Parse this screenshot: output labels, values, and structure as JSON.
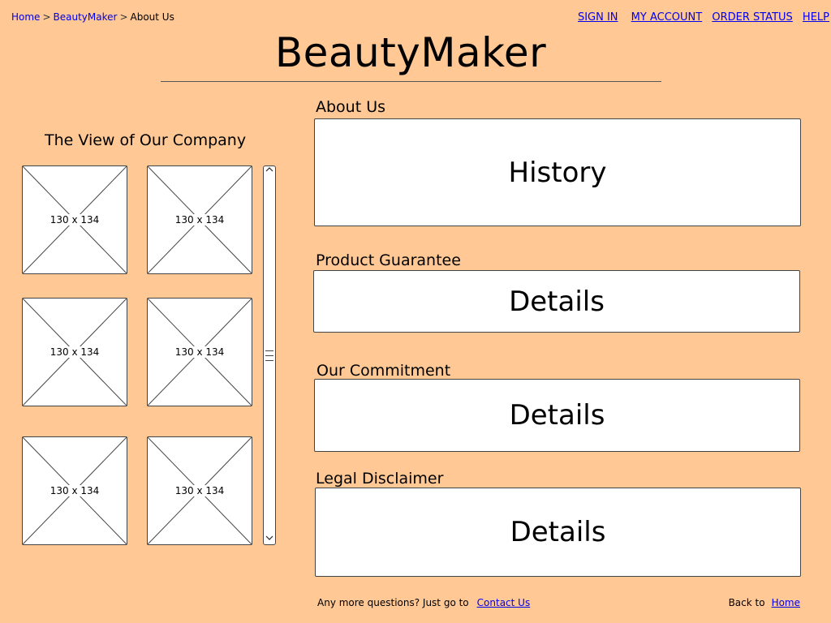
{
  "breadcrumb": {
    "items": [
      "Home",
      "BeautyMaker",
      "About Us"
    ],
    "separator": ">"
  },
  "top_nav": {
    "sign_in": "SIGN IN",
    "my_account": "MY ACCOUNT",
    "order_status": "ORDER STATUS",
    "help": "HELP"
  },
  "site_title": "BeautyMaker",
  "gallery": {
    "title": "The View of Our Company",
    "thumbnails": [
      "130 x 134",
      "130 x 134",
      "130 x 134",
      "130 x 134",
      "130 x 134",
      "130 x 134"
    ]
  },
  "scrollbar": {
    "up_icon": "chevron-up-icon",
    "down_icon": "chevron-down-icon"
  },
  "sections": [
    {
      "label": "About Us",
      "content": "History"
    },
    {
      "label": "Product Guarantee",
      "content": "Details"
    },
    {
      "label": "Our Commitment",
      "content": "Details"
    },
    {
      "label": "Legal Disclaimer",
      "content": "Details"
    }
  ],
  "footer": {
    "question_text": "Any more questions? Just go to",
    "contact_link": "Contact Us",
    "back_text": "Back to",
    "home_link": "Home"
  },
  "colors": {
    "page_background": "#ffc895",
    "link": "#0000ee",
    "box_fill": "#ffffff",
    "stroke": "#444444"
  }
}
